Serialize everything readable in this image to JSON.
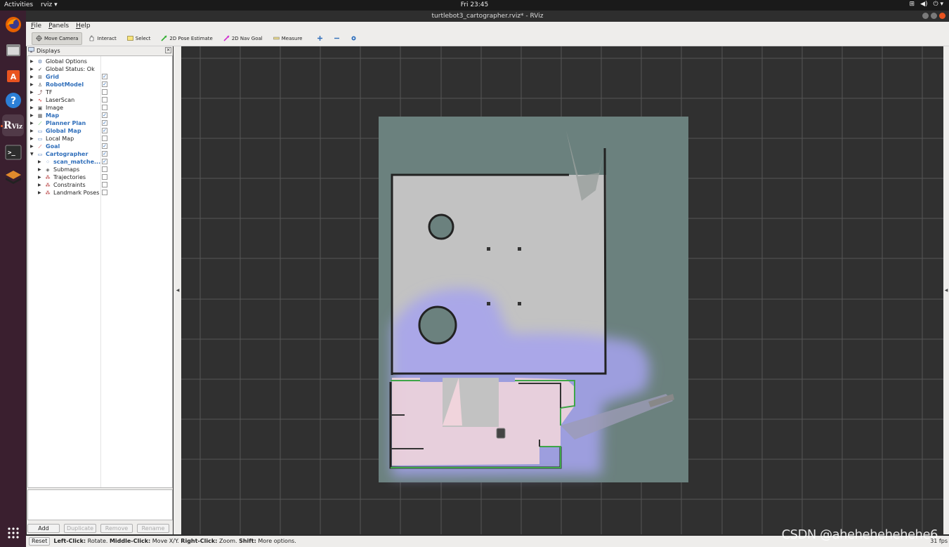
{
  "topbar": {
    "activities": "Activities",
    "app_menu": "rviz ▾",
    "clock": "Fri 23:45",
    "tray": [
      "network-icon",
      "volume-icon",
      "power-icon"
    ]
  },
  "window": {
    "title": "turtlebot3_cartographer.rviz* - RViz"
  },
  "menu": {
    "file": "File",
    "panels": "Panels",
    "help": "Help"
  },
  "toolbar": {
    "move_camera": "Move Camera",
    "interact": "Interact",
    "select": "Select",
    "pose_estimate": "2D Pose Estimate",
    "nav_goal": "2D Nav Goal",
    "measure": "Measure"
  },
  "panel": {
    "title": "Displays",
    "rows": [
      {
        "label": "Global Options",
        "bold": false,
        "checkbox": null,
        "expanded": false,
        "depth": 0,
        "icon": "gear-icon"
      },
      {
        "label": "Global Status: Ok",
        "bold": false,
        "checkbox": null,
        "expanded": false,
        "depth": 0,
        "icon": "check-icon"
      },
      {
        "label": "Grid",
        "bold": true,
        "checkbox": true,
        "expanded": false,
        "depth": 0,
        "icon": "grid-icon"
      },
      {
        "label": "RobotModel",
        "bold": true,
        "checkbox": true,
        "expanded": false,
        "depth": 0,
        "icon": "robot-icon"
      },
      {
        "label": "TF",
        "bold": false,
        "checkbox": false,
        "expanded": false,
        "depth": 0,
        "icon": "tf-icon"
      },
      {
        "label": "LaserScan",
        "bold": false,
        "checkbox": false,
        "expanded": false,
        "depth": 0,
        "icon": "laser-icon"
      },
      {
        "label": "Image",
        "bold": false,
        "checkbox": false,
        "expanded": false,
        "depth": 0,
        "icon": "image-icon"
      },
      {
        "label": "Map",
        "bold": true,
        "checkbox": true,
        "expanded": false,
        "depth": 0,
        "icon": "map-icon"
      },
      {
        "label": "Planner Plan",
        "bold": true,
        "checkbox": true,
        "expanded": false,
        "depth": 0,
        "icon": "path-icon"
      },
      {
        "label": "Global Map",
        "bold": true,
        "checkbox": true,
        "expanded": false,
        "depth": 0,
        "icon": "folder-icon"
      },
      {
        "label": "Local Map",
        "bold": false,
        "checkbox": false,
        "expanded": false,
        "depth": 0,
        "icon": "folder-icon"
      },
      {
        "label": "Goal",
        "bold": true,
        "checkbox": true,
        "expanded": false,
        "depth": 0,
        "icon": "goal-icon"
      },
      {
        "label": "Cartographer",
        "bold": true,
        "checkbox": true,
        "expanded": true,
        "depth": 0,
        "icon": "folder-icon"
      },
      {
        "label": "scan_matche...",
        "bold": true,
        "checkbox": true,
        "expanded": false,
        "depth": 1,
        "icon": "pointcloud-icon"
      },
      {
        "label": "Submaps",
        "bold": false,
        "checkbox": false,
        "expanded": false,
        "depth": 1,
        "icon": "submap-icon"
      },
      {
        "label": "Trajectories",
        "bold": false,
        "checkbox": false,
        "expanded": false,
        "depth": 1,
        "icon": "marker-icon"
      },
      {
        "label": "Constraints",
        "bold": false,
        "checkbox": false,
        "expanded": false,
        "depth": 1,
        "icon": "marker-icon"
      },
      {
        "label": "Landmark Poses",
        "bold": false,
        "checkbox": false,
        "expanded": false,
        "depth": 1,
        "icon": "marker-icon"
      }
    ],
    "buttons": {
      "add": "Add",
      "duplicate": "Duplicate",
      "remove": "Remove",
      "rename": "Rename"
    }
  },
  "status": {
    "reset": "Reset",
    "hint_left_key": "Left-Click:",
    "hint_left": "Rotate.",
    "hint_mid_key": "Middle-Click:",
    "hint_mid": "Move X/Y.",
    "hint_right_key": "Right-Click:",
    "hint_right": "Zoom.",
    "hint_shift_key": "Shift:",
    "hint_shift": "More options.",
    "fps": "31 fps"
  },
  "watermark": "CSDN @ahehehehehehe6",
  "colors": {
    "accent": "#e95420",
    "bold_label": "#2f6eba",
    "view_bg": "#303030",
    "map_unknown": "#6b817e",
    "map_free": "#c2c2c2",
    "costmap": "#a6a2ee"
  }
}
